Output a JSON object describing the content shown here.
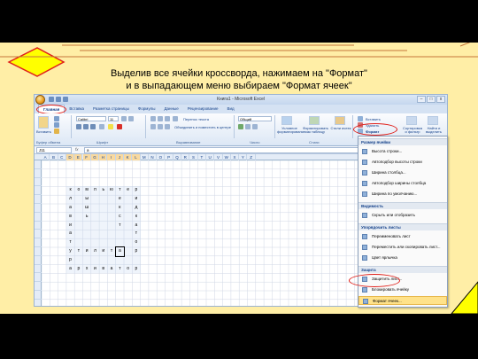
{
  "heading": {
    "line1": "Выделив все ячейки кроссворда, нажимаем на \"Формат\"",
    "line2": "и в выпадающем меню выбираем \"Формат ячеек\""
  },
  "excel": {
    "window_title": "Книга1 - Microsoft Excel",
    "window_controls": [
      "–",
      "□",
      "x"
    ],
    "tabs": [
      "Главная",
      "Вставка",
      "Разметка страницы",
      "Формулы",
      "Данные",
      "Рецензирование",
      "Вид"
    ],
    "ribbon": {
      "paste": "Вставить",
      "clipboard": "Буфер обмена",
      "font_name": "Calibri",
      "font_size": "11",
      "font_group": "Шрифт",
      "wrap_text": "Перенос текста",
      "merge_center": "Объединить и поместить в центре",
      "alignment_group": "Выравнивание",
      "number_format": "Общий",
      "number_group": "Число",
      "conditional": "Условное форматирование",
      "format_table": "Форматировать как таблицу",
      "cell_styles": "Стили ячеек",
      "styles_group": "Стили",
      "insert": "Вставить",
      "delete": "Удалить",
      "format": "Формат",
      "sort_filter": "Сортировка и фильтр",
      "find_select": "Найти и выделить"
    },
    "formula_bar": {
      "name_box": "J11",
      "fx": "fx",
      "content": "а"
    },
    "columns": [
      "A",
      "B",
      "C",
      "D",
      "E",
      "F",
      "G",
      "H",
      "I",
      "J",
      "K",
      "L",
      "M",
      "N",
      "O",
      "P",
      "Q",
      "R",
      "S",
      "T",
      "U",
      "V",
      "W",
      "X",
      "Y",
      "Z"
    ],
    "crossword": [
      {
        "row": 4,
        "letters": [
          "к",
          "о",
          "м",
          "п",
          "ь",
          "ю",
          "т",
          "е",
          "р"
        ]
      },
      {
        "row": 5,
        "letters": [
          "л",
          "",
          "ы",
          "",
          "",
          "",
          "е",
          "",
          "и"
        ]
      },
      {
        "row": 6,
        "letters": [
          "а",
          "",
          "ш",
          "",
          "",
          "",
          "к",
          "",
          "д"
        ]
      },
      {
        "row": 7,
        "letters": [
          "в",
          "",
          "ь",
          "",
          "",
          "",
          "с",
          "",
          "к"
        ]
      },
      {
        "row": 8,
        "letters": [
          "и",
          "",
          "",
          "",
          "",
          "",
          "т",
          "",
          "а"
        ]
      },
      {
        "row": 9,
        "letters": [
          "а",
          "",
          "",
          "",
          "",
          "",
          "",
          "",
          "т"
        ]
      },
      {
        "row": 10,
        "letters": [
          "т",
          "",
          "",
          "",
          "",
          "",
          "",
          "",
          "о"
        ]
      },
      {
        "row": 11,
        "letters": [
          "у",
          "т",
          "и",
          "л",
          "и",
          "т",
          "а",
          "",
          "р"
        ]
      },
      {
        "row": 12,
        "letters": [
          "р",
          "",
          "",
          "",
          "",
          "",
          "",
          "",
          ""
        ]
      },
      {
        "row": 13,
        "letters": [
          "а",
          "р",
          "х",
          "и",
          "в",
          "а",
          "т",
          "о",
          "р"
        ]
      }
    ],
    "format_menu": {
      "sections": [
        {
          "title": "Размер ячейки",
          "items": [
            "Высота строки...",
            "Автоподбор высоты строки",
            "Ширина столбца...",
            "Автоподбор ширины столбца",
            "Ширина по умолчанию..."
          ]
        },
        {
          "title": "Видимость",
          "items": [
            "Скрыть или отобразить"
          ]
        },
        {
          "title": "Упорядочить листы",
          "items": [
            "Переименовать лист",
            "Переместить или скопировать лист...",
            "Цвет ярлычка"
          ]
        },
        {
          "title": "Защита",
          "items": [
            "Защитить лист...",
            "Блокировать ячейку",
            "Формат ячеек..."
          ]
        }
      ]
    }
  },
  "colors": {
    "slide_bg": "#FFEEA6",
    "diamond_fill": "#FFFF00",
    "accent_red": "#E0201A",
    "line_orange": "#C6763A"
  }
}
